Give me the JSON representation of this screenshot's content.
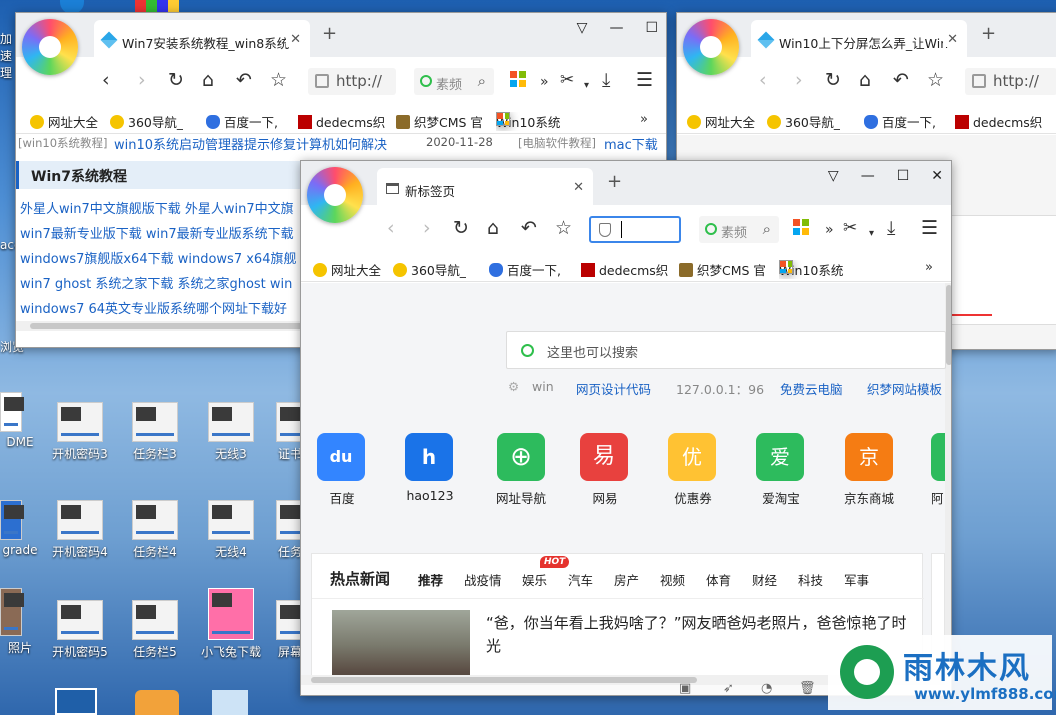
{
  "desktop": {
    "icons": [
      {
        "label": "DME",
        "thumb": false
      },
      {
        "label": "开机密码3",
        "thumb": true
      },
      {
        "label": "任务栏3",
        "thumb": true
      },
      {
        "label": "无线3",
        "thumb": true
      },
      {
        "label": "证书",
        "thumb": true
      },
      {
        "label": "grade",
        "thumb": false
      },
      {
        "label": "开机密码4",
        "thumb": true
      },
      {
        "label": "任务栏4",
        "thumb": true
      },
      {
        "label": "无线4",
        "thumb": true
      },
      {
        "label": "任务",
        "thumb": true
      },
      {
        "label": "照片",
        "thumb": false
      },
      {
        "label": "开机密码5",
        "thumb": true
      },
      {
        "label": "任务栏5",
        "thumb": true
      },
      {
        "label": "小飞兔下载",
        "thumb": false
      },
      {
        "label": "屏幕",
        "thumb": true
      }
    ],
    "top_left_text": "加速\n理",
    "left_side_labels": [
      "ace",
      "浏览"
    ]
  },
  "window1": {
    "tab_title": "Win7安装系统教程_win8系统",
    "address": "http://",
    "search_placeholder": "素频",
    "bookmarks": [
      "网址大全",
      "360导航_",
      "百度一下,",
      "dedecms织",
      "织梦CMS 官",
      "Win10系统"
    ],
    "more": "»",
    "news_row": {
      "tag": "[win10系统教程]",
      "title": "win10系统启动管理器提示修复计算机如何解决",
      "date": "2020-11-28",
      "tag2": "[电脑软件教程]",
      "title2": "mac下载"
    },
    "section_title": "Win7系统教程",
    "links": [
      "外星人win7中文旗舰版下载 外星人win7中文旗",
      "win7最新专业版下载 win7最新专业版系统下载",
      "windows7旗舰版x64下载 windows7 x64旗舰",
      "win7 ghost 系统之家下载 系统之家ghost win",
      "windows7 64英文专业版系统哪个网址下载好"
    ]
  },
  "window2": {
    "tab_title": "Win10上下分屏怎么弄_让Win",
    "address": "http://",
    "bookmarks": [
      "网址大全",
      "360导航_",
      "百度一下,",
      "dedecms织"
    ]
  },
  "window3": {
    "tab_title": "新标签页",
    "search_placeholder": "素频",
    "bookmarks": [
      "网址大全",
      "360导航_",
      "百度一下,",
      "dedecms织",
      "织梦CMS 官",
      "Win10系统"
    ],
    "more": "»",
    "big_search_placeholder": "这里也可以搜索",
    "quick_links": [
      "win",
      "网页设计代码",
      "127.0.0.1：96",
      "免费云电脑",
      "织梦网站模板"
    ],
    "apps": [
      {
        "name": "百度",
        "glyph": "du",
        "color": "#3385ff"
      },
      {
        "name": "hao123",
        "glyph": "h",
        "color": "#1a73e8"
      },
      {
        "name": "网址导航",
        "glyph": "⊕",
        "color": "#2dbb5d"
      },
      {
        "name": "网易",
        "glyph": "易",
        "color": "#e8413e"
      },
      {
        "name": "优惠券",
        "glyph": "优",
        "color": "#ffc233"
      },
      {
        "name": "爱淘宝",
        "glyph": "爱",
        "color": "#2dbb5d"
      },
      {
        "name": "京东商城",
        "glyph": "京",
        "color": "#f57c13"
      },
      {
        "name": "阿",
        "glyph": "",
        "color": "#2dbb5d"
      }
    ],
    "news_title": "热点新闻",
    "news_tabs": [
      "推荐",
      "战疫情",
      "娱乐",
      "汽车",
      "房产",
      "视频",
      "体育",
      "财经",
      "科技",
      "军事"
    ],
    "hot_badge": "HOT",
    "headline": "“爸，你当年看上我妈啥了？”网友晒爸妈老照片，爸爸惊艳了时光"
  },
  "watermark": {
    "title": "雨林木风",
    "url": "www.ylmf888.com"
  },
  "colors": {
    "accent": "#3b86ea",
    "link": "#1a62c4",
    "section_bg": "#e4eef8",
    "watermark": "#1b6fc2"
  }
}
